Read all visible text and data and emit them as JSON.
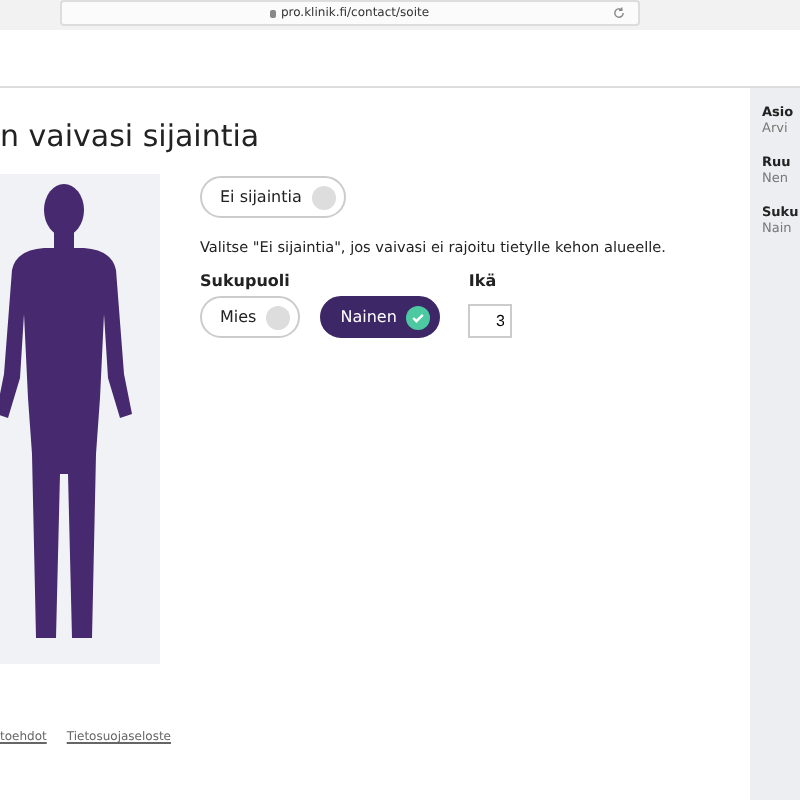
{
  "browser": {
    "url": "pro.klinik.fi/contact/soite"
  },
  "title": "n vaivasi sijaintia",
  "no_location": {
    "label": "Ei sijaintia",
    "selected": false
  },
  "hint": "Valitse \"Ei sijaintia\", jos vaivasi ei rajoitu tietylle kehon alueelle.",
  "gender": {
    "label": "Sukupuoli",
    "options": [
      {
        "label": "Mies",
        "selected": false
      },
      {
        "label": "Nainen",
        "selected": true
      }
    ]
  },
  "age": {
    "label": "Ikä",
    "value": "3"
  },
  "footer_links": [
    "toehdot",
    "Tietosuojaseloste"
  ],
  "sidebar": [
    {
      "label": "Asio",
      "value": "Arvi"
    },
    {
      "label": "Ruu",
      "value": "Nen"
    },
    {
      "label": "Suku",
      "value": "Nain"
    }
  ]
}
